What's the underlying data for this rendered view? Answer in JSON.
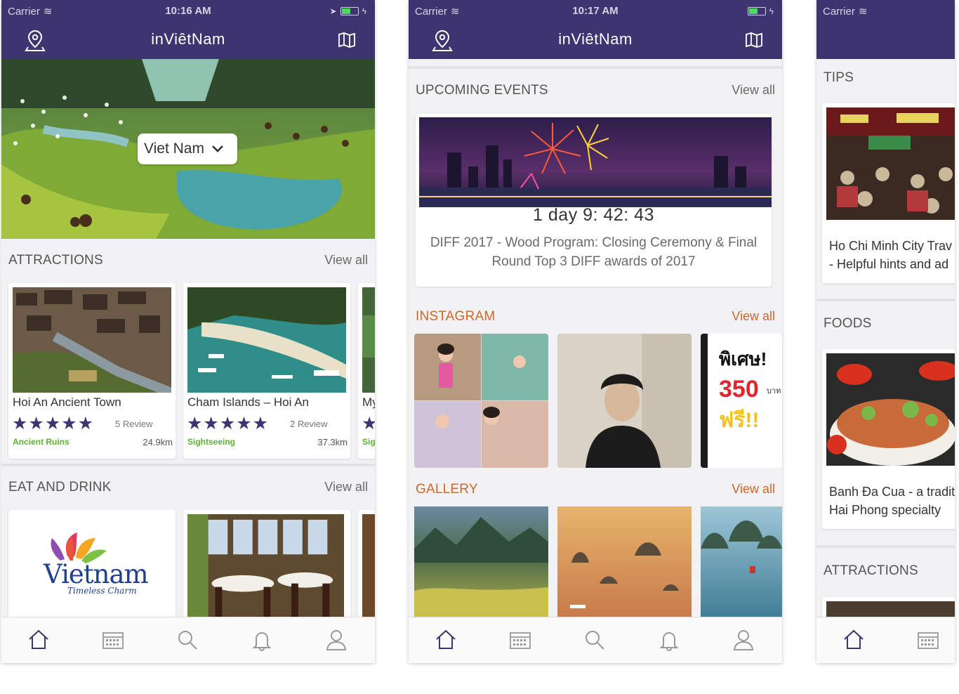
{
  "status_bar": {
    "carrier": "Carrier",
    "time_left": "10:16 AM",
    "time_middle": "10:17 AM"
  },
  "app": {
    "title": "inViêtNam"
  },
  "hero": {
    "location_select": "Viet Nam"
  },
  "attractions": {
    "title": "ATTRACTIONS",
    "view_all": "View all",
    "cards": [
      {
        "title": "Hoi An Ancient Town",
        "stars": "★★★★★",
        "reviews": "5 Review",
        "category": "Ancient Ruins",
        "distance": "24.9km"
      },
      {
        "title": "Cham Islands – Hoi An",
        "stars": "★★★★★",
        "reviews": "2 Review",
        "category": "Sightseeing",
        "distance": "37.3km"
      },
      {
        "title": "My",
        "stars": "★",
        "category": "Sig"
      }
    ]
  },
  "eat_drink": {
    "title": "EAT AND DRINK",
    "view_all": "View all",
    "logo_text": "Vietnam",
    "logo_tagline": "Timeless Charm"
  },
  "events": {
    "title": "UPCOMING EVENTS",
    "view_all": "View all",
    "countdown": "1 day  9: 42: 43",
    "description": "DIFF 2017 - Wood Program: Closing Ceremony & Final Round Top 3 DIFF awards of 2017"
  },
  "instagram": {
    "title": "INSTAGRAM",
    "view_all": "View all",
    "promo": {
      "headline": "พิเศษ!",
      "price": "350",
      "unit": "บาท",
      "free": "ฟรี!!"
    }
  },
  "gallery": {
    "title": "GALLERY",
    "view_all": "View all"
  },
  "tips": {
    "title": "TIPS",
    "card_title_line1": "Ho Chi Minh City Trav",
    "card_title_line2": "- Helpful hints and ad"
  },
  "foods": {
    "title": "FOODS",
    "card_title_line1": "Banh Đa Cua - a tradit",
    "card_title_line2": "Hai Phong specialty"
  },
  "attractions_right": {
    "title": "ATTRACTIONS"
  },
  "tabs": [
    "home-icon",
    "calendar-icon",
    "search-icon",
    "bell-icon",
    "user-icon"
  ],
  "colors": {
    "header": "#3d3470",
    "accent_orange": "#d4662a",
    "category_green": "#5bb32f",
    "star": "#3d3470"
  }
}
